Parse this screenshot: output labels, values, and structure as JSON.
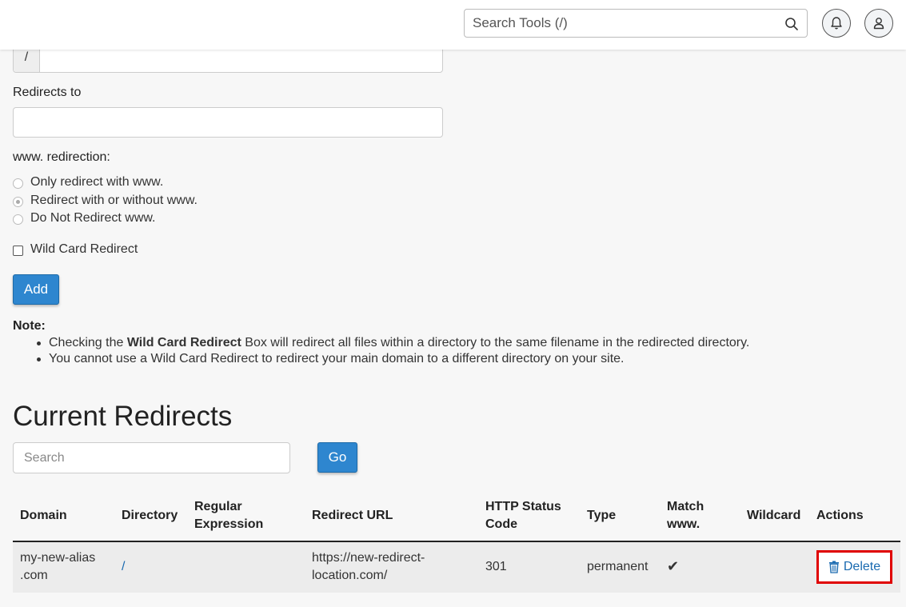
{
  "header": {
    "search_placeholder": "Search Tools (/)"
  },
  "form": {
    "path_prefix": "/",
    "redirects_to_label": "Redirects to",
    "www_label": "www. redirection:",
    "www_options": [
      {
        "label": "Only redirect with www.",
        "checked": false
      },
      {
        "label": "Redirect with or without www.",
        "checked": true
      },
      {
        "label": "Do Not Redirect www.",
        "checked": false
      }
    ],
    "wildcard_label": "Wild Card Redirect",
    "add_label": "Add"
  },
  "note": {
    "title": "Note:",
    "item1_prefix": "Checking the ",
    "item1_bold": "Wild Card Redirect",
    "item1_suffix": " Box will redirect all files within a directory to the same filename in the redirected directory.",
    "item2": "You cannot use a Wild Card Redirect to redirect your main domain to a different directory on your site."
  },
  "current": {
    "title": "Current Redirects",
    "search_placeholder": "Search",
    "go_label": "Go"
  },
  "table": {
    "headers": {
      "domain": "Domain",
      "directory": "Directory",
      "regex_1": "Regular",
      "regex_2": "Expression",
      "redirect_url": "Redirect URL",
      "status_1": "HTTP Status",
      "status_2": "Code",
      "type": "Type",
      "match_1": "Match",
      "match_2": "www.",
      "wildcard": "Wildcard",
      "actions": "Actions"
    },
    "row": {
      "domain_1": "my-new-alias",
      "domain_2": ".com",
      "directory": "/",
      "regex": "",
      "redirect_1": "https://new-redirect-",
      "redirect_2": "location.com/",
      "status": "301",
      "type": "permanent",
      "match_www": "✔",
      "wildcard": "",
      "delete_label": "Delete"
    }
  },
  "colors": {
    "primary_button": "#2e86cf",
    "link": "#1a6ab0",
    "highlight": "#e00000"
  }
}
